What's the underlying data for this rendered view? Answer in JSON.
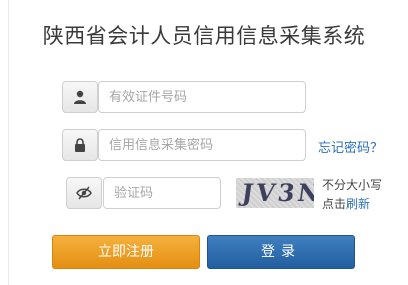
{
  "title": "陕西省会计人员信用信息采集系统",
  "id_field": {
    "placeholder": "有效证件号码",
    "icon": "user-icon"
  },
  "password_field": {
    "placeholder": "信用信息采集密码",
    "icon": "lock-icon"
  },
  "forgot_password": "忘记密码？",
  "captcha_field": {
    "placeholder": "验证码",
    "icon": "eye-icon"
  },
  "captcha_image_text": "JV3N",
  "captcha_hint": {
    "case": "不分大小写",
    "click": "点击",
    "refresh": "刷新"
  },
  "buttons": {
    "register": "立即注册",
    "login": "登录"
  },
  "colors": {
    "register": "#e99a1c",
    "login": "#2c6aa8",
    "link": "#2a6fbd"
  }
}
